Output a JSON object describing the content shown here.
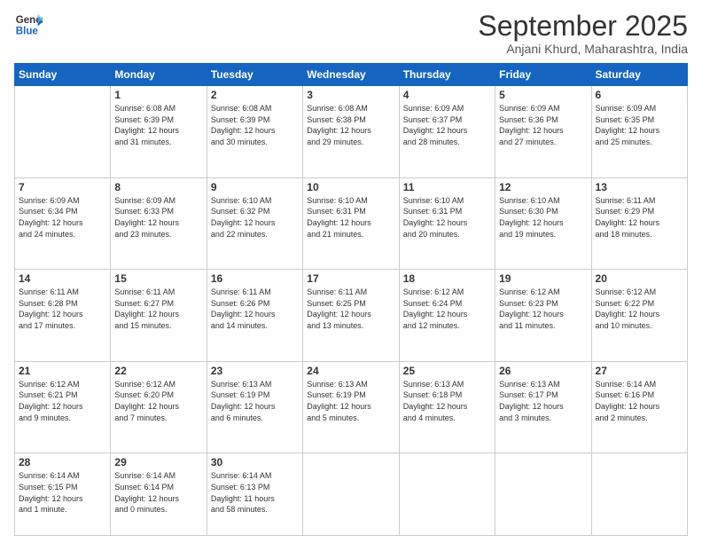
{
  "header": {
    "logo_line1": "General",
    "logo_line2": "Blue",
    "month": "September 2025",
    "location": "Anjani Khurd, Maharashtra, India"
  },
  "weekdays": [
    "Sunday",
    "Monday",
    "Tuesday",
    "Wednesday",
    "Thursday",
    "Friday",
    "Saturday"
  ],
  "weeks": [
    [
      {
        "day": "",
        "info": ""
      },
      {
        "day": "1",
        "info": "Sunrise: 6:08 AM\nSunset: 6:39 PM\nDaylight: 12 hours\nand 31 minutes."
      },
      {
        "day": "2",
        "info": "Sunrise: 6:08 AM\nSunset: 6:39 PM\nDaylight: 12 hours\nand 30 minutes."
      },
      {
        "day": "3",
        "info": "Sunrise: 6:08 AM\nSunset: 6:38 PM\nDaylight: 12 hours\nand 29 minutes."
      },
      {
        "day": "4",
        "info": "Sunrise: 6:09 AM\nSunset: 6:37 PM\nDaylight: 12 hours\nand 28 minutes."
      },
      {
        "day": "5",
        "info": "Sunrise: 6:09 AM\nSunset: 6:36 PM\nDaylight: 12 hours\nand 27 minutes."
      },
      {
        "day": "6",
        "info": "Sunrise: 6:09 AM\nSunset: 6:35 PM\nDaylight: 12 hours\nand 25 minutes."
      }
    ],
    [
      {
        "day": "7",
        "info": "Sunrise: 6:09 AM\nSunset: 6:34 PM\nDaylight: 12 hours\nand 24 minutes."
      },
      {
        "day": "8",
        "info": "Sunrise: 6:09 AM\nSunset: 6:33 PM\nDaylight: 12 hours\nand 23 minutes."
      },
      {
        "day": "9",
        "info": "Sunrise: 6:10 AM\nSunset: 6:32 PM\nDaylight: 12 hours\nand 22 minutes."
      },
      {
        "day": "10",
        "info": "Sunrise: 6:10 AM\nSunset: 6:31 PM\nDaylight: 12 hours\nand 21 minutes."
      },
      {
        "day": "11",
        "info": "Sunrise: 6:10 AM\nSunset: 6:31 PM\nDaylight: 12 hours\nand 20 minutes."
      },
      {
        "day": "12",
        "info": "Sunrise: 6:10 AM\nSunset: 6:30 PM\nDaylight: 12 hours\nand 19 minutes."
      },
      {
        "day": "13",
        "info": "Sunrise: 6:11 AM\nSunset: 6:29 PM\nDaylight: 12 hours\nand 18 minutes."
      }
    ],
    [
      {
        "day": "14",
        "info": "Sunrise: 6:11 AM\nSunset: 6:28 PM\nDaylight: 12 hours\nand 17 minutes."
      },
      {
        "day": "15",
        "info": "Sunrise: 6:11 AM\nSunset: 6:27 PM\nDaylight: 12 hours\nand 15 minutes."
      },
      {
        "day": "16",
        "info": "Sunrise: 6:11 AM\nSunset: 6:26 PM\nDaylight: 12 hours\nand 14 minutes."
      },
      {
        "day": "17",
        "info": "Sunrise: 6:11 AM\nSunset: 6:25 PM\nDaylight: 12 hours\nand 13 minutes."
      },
      {
        "day": "18",
        "info": "Sunrise: 6:12 AM\nSunset: 6:24 PM\nDaylight: 12 hours\nand 12 minutes."
      },
      {
        "day": "19",
        "info": "Sunrise: 6:12 AM\nSunset: 6:23 PM\nDaylight: 12 hours\nand 11 minutes."
      },
      {
        "day": "20",
        "info": "Sunrise: 6:12 AM\nSunset: 6:22 PM\nDaylight: 12 hours\nand 10 minutes."
      }
    ],
    [
      {
        "day": "21",
        "info": "Sunrise: 6:12 AM\nSunset: 6:21 PM\nDaylight: 12 hours\nand 9 minutes."
      },
      {
        "day": "22",
        "info": "Sunrise: 6:12 AM\nSunset: 6:20 PM\nDaylight: 12 hours\nand 7 minutes."
      },
      {
        "day": "23",
        "info": "Sunrise: 6:13 AM\nSunset: 6:19 PM\nDaylight: 12 hours\nand 6 minutes."
      },
      {
        "day": "24",
        "info": "Sunrise: 6:13 AM\nSunset: 6:19 PM\nDaylight: 12 hours\nand 5 minutes."
      },
      {
        "day": "25",
        "info": "Sunrise: 6:13 AM\nSunset: 6:18 PM\nDaylight: 12 hours\nand 4 minutes."
      },
      {
        "day": "26",
        "info": "Sunrise: 6:13 AM\nSunset: 6:17 PM\nDaylight: 12 hours\nand 3 minutes."
      },
      {
        "day": "27",
        "info": "Sunrise: 6:14 AM\nSunset: 6:16 PM\nDaylight: 12 hours\nand 2 minutes."
      }
    ],
    [
      {
        "day": "28",
        "info": "Sunrise: 6:14 AM\nSunset: 6:15 PM\nDaylight: 12 hours\nand 1 minute."
      },
      {
        "day": "29",
        "info": "Sunrise: 6:14 AM\nSunset: 6:14 PM\nDaylight: 12 hours\nand 0 minutes."
      },
      {
        "day": "30",
        "info": "Sunrise: 6:14 AM\nSunset: 6:13 PM\nDaylight: 11 hours\nand 58 minutes."
      },
      {
        "day": "",
        "info": ""
      },
      {
        "day": "",
        "info": ""
      },
      {
        "day": "",
        "info": ""
      },
      {
        "day": "",
        "info": ""
      }
    ]
  ]
}
